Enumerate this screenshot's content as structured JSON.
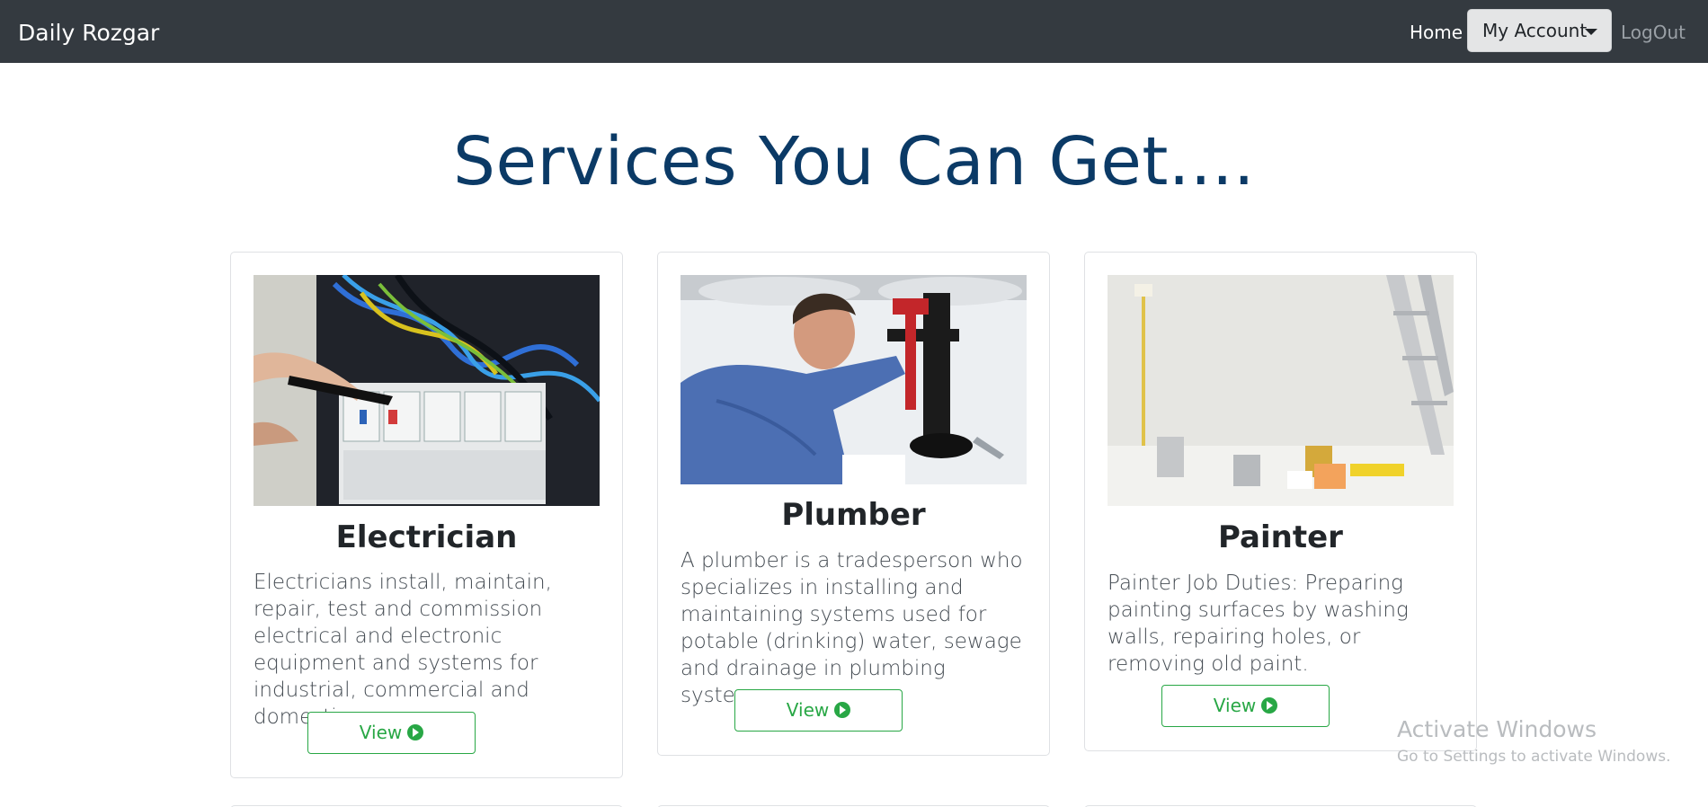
{
  "navbar": {
    "brand": "Daily Rozgar",
    "home": "Home",
    "account": "My Account",
    "logout": "LogOut"
  },
  "page": {
    "headline": "Services You Can Get...."
  },
  "cards": [
    {
      "title": "Electrician",
      "text": "Electricians install, maintain, repair, test and commission electrical and electronic equipment and systems for industrial, commercial and domestic purposes.",
      "button": "View"
    },
    {
      "title": "Plumber",
      "text": "A plumber is a tradesperson who specializes in installing and maintaining systems used for potable (drinking) water, sewage and drainage in plumbing systems.",
      "button": "View"
    },
    {
      "title": "Painter",
      "text": "Painter Job Duties: Preparing painting surfaces by washing walls, repairing holes, or removing old paint.",
      "button": "View"
    }
  ],
  "watermark": {
    "title": "Activate Windows",
    "subtitle": "Go to Settings to activate Windows."
  },
  "colors": {
    "navbar": "#343a40",
    "headline": "#0b3a66",
    "accent": "#28a745"
  }
}
